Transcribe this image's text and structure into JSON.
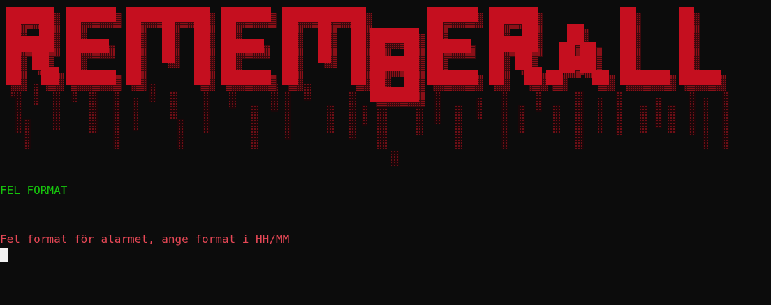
{
  "banner": {
    "art_name": "REMEMBERALL ascii-art logo",
    "color": "#c50f1f"
  },
  "console": {
    "status_text": "FEL FORMAT",
    "status_color": "#16c60c",
    "message_text": "Fel format för alarmet, ange format i HH/MM",
    "message_color": "#e74856",
    "cursor_color": "#f2f2f2"
  }
}
